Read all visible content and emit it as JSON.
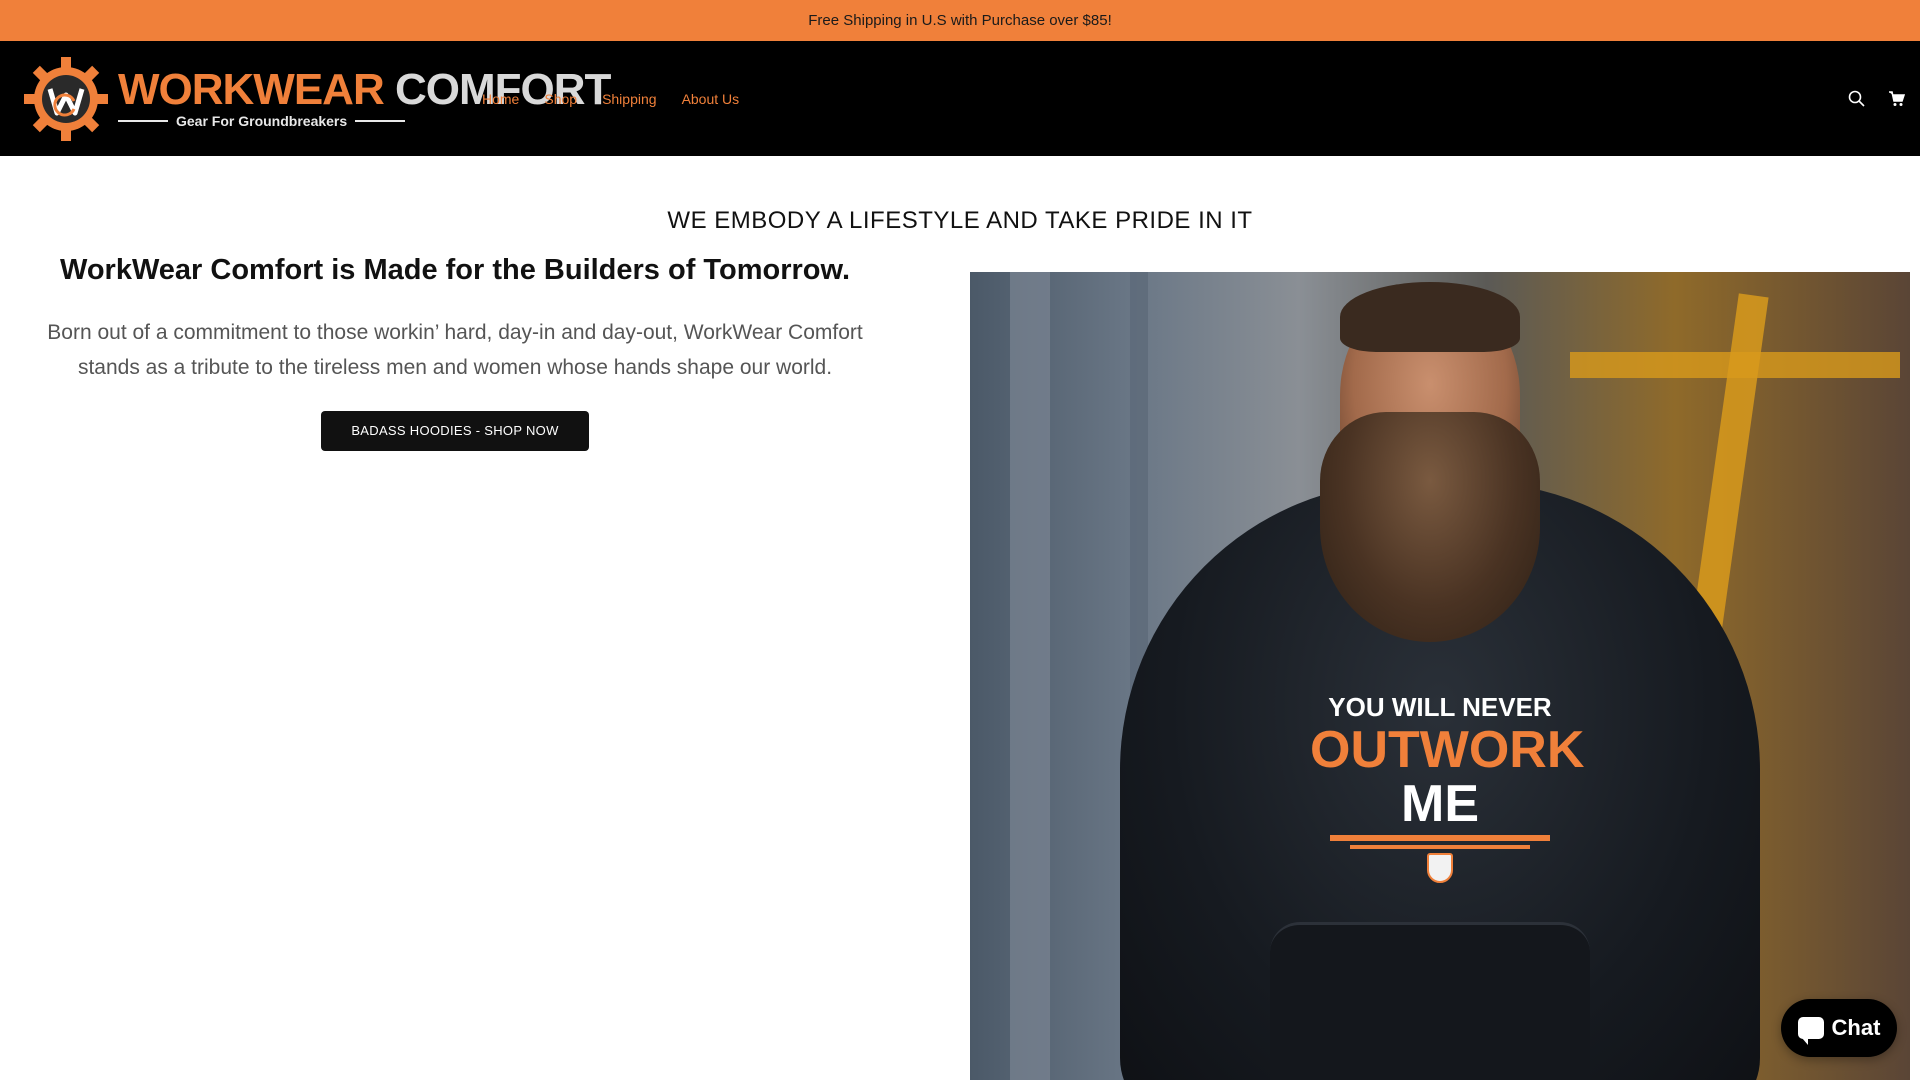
{
  "announcement": {
    "text": "Free Shipping in U.S with Purchase over $85!"
  },
  "header": {
    "logo": {
      "title_part1": "WORKWEAR",
      "title_part2": "COMFORT",
      "tagline": "Gear For Groundbreakers"
    },
    "nav": [
      {
        "label": "Home"
      },
      {
        "label": "Shop"
      },
      {
        "label": "Shipping"
      },
      {
        "label": "About Us"
      }
    ],
    "icons": [
      "search-icon",
      "cart-icon"
    ]
  },
  "main": {
    "tagline": "WE EMBODY A LIFESTYLE AND TAKE PRIDE IN IT",
    "heading": "WorkWear Comfort is Made for the Builders of Tomorrow.",
    "body": "Born out of a commitment to those workin’ hard, day-in and day-out, WorkWear Comfort stands as a tribute to the tireless men and women whose hands shape our world.",
    "cta_label": "BADASS HOODIES - SHOP NOW"
  },
  "hero_image": {
    "print_line1": "YOU WILL NEVER",
    "print_line2_a": "OUTWORK",
    "print_line2_b": "ME"
  },
  "chat": {
    "label": "Chat"
  },
  "colors": {
    "accent": "#f0803a",
    "header_bg": "#000000",
    "cta_bg": "#111111"
  }
}
